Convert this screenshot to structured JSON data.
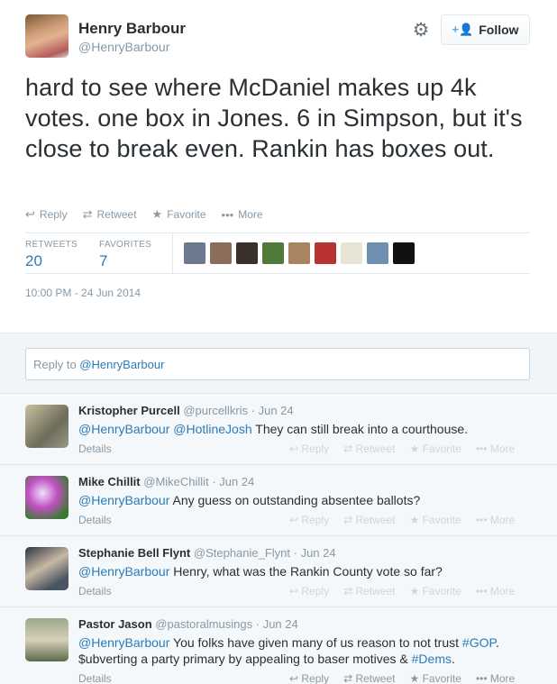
{
  "author": {
    "name": "Henry Barbour",
    "handle": "@HenryBarbour",
    "follow_label": "Follow"
  },
  "tweet": {
    "text": "hard to see where McDaniel makes up 4k votes. one box in Jones. 6 in Simpson, but it's close to break even. Rankin has boxes out.",
    "actions": {
      "reply": "Reply",
      "retweet": "Retweet",
      "favorite": "Favorite",
      "more": "More"
    },
    "stats": {
      "retweets_label": "RETWEETS",
      "retweets": "20",
      "favorites_label": "FAVORITES",
      "favorites": "7"
    },
    "timestamp": "10:00 PM - 24 Jun 2014"
  },
  "favoriter_avatars": [
    "#6b7a8f",
    "#8a6d5a",
    "#3a2f2a",
    "#4f7a3a",
    "#a88560",
    "#b83232",
    "#e8e4d6",
    "#6f8fb0",
    "#111111"
  ],
  "reply_box": {
    "prefix": "Reply to ",
    "mention": "@HenryBarbour"
  },
  "replies": [
    {
      "name": "Kristopher Purcell",
      "handle": "@purcellkris",
      "time": "· Jun 24",
      "mentions": "@HenryBarbour @HotlineJosh",
      "text": " They can still break into a courthouse.",
      "details": "Details",
      "avatar_color": "#8c8a74"
    },
    {
      "name": "Mike Chillit",
      "handle": "@MikeChillit",
      "time": "· Jun 24",
      "mentions": "@HenryBarbour",
      "text": " Any guess on outstanding absentee ballots?",
      "details": "Details",
      "avatar_color": "#b04aa8"
    },
    {
      "name": "Stephanie Bell Flynt",
      "handle": "@Stephanie_Flynt",
      "time": "· Jun 24",
      "mentions": "@HenryBarbour",
      "text": " Henry, what was the Rankin County vote so far?",
      "details": "Details",
      "avatar_color": "#4a5560"
    },
    {
      "name": "Pastor Jason",
      "handle": "@pastoralmusings",
      "time": "· Jun 24",
      "mentions": "@HenryBarbour",
      "text_a": " You folks have given many of us reason to not trust ",
      "tag1": "#GOP",
      "text_b": ". $ubverting a party primary by appealing to baser motives & ",
      "tag2": "#Dems",
      "text_c": ".",
      "details": "Details",
      "avatar_color": "#6f7d5e"
    }
  ],
  "reply_actions": {
    "reply": "Reply",
    "retweet": "Retweet",
    "favorite": "Favorite",
    "more": "More"
  },
  "colors": {
    "link": "#2b7bb9",
    "muted": "#8899a6",
    "accent": "#55acee"
  },
  "icons": [
    "settings-gear-icon",
    "follow-person-plus-icon",
    "reply-arrow-icon",
    "retweet-icon",
    "star-icon",
    "more-dots-icon"
  ]
}
